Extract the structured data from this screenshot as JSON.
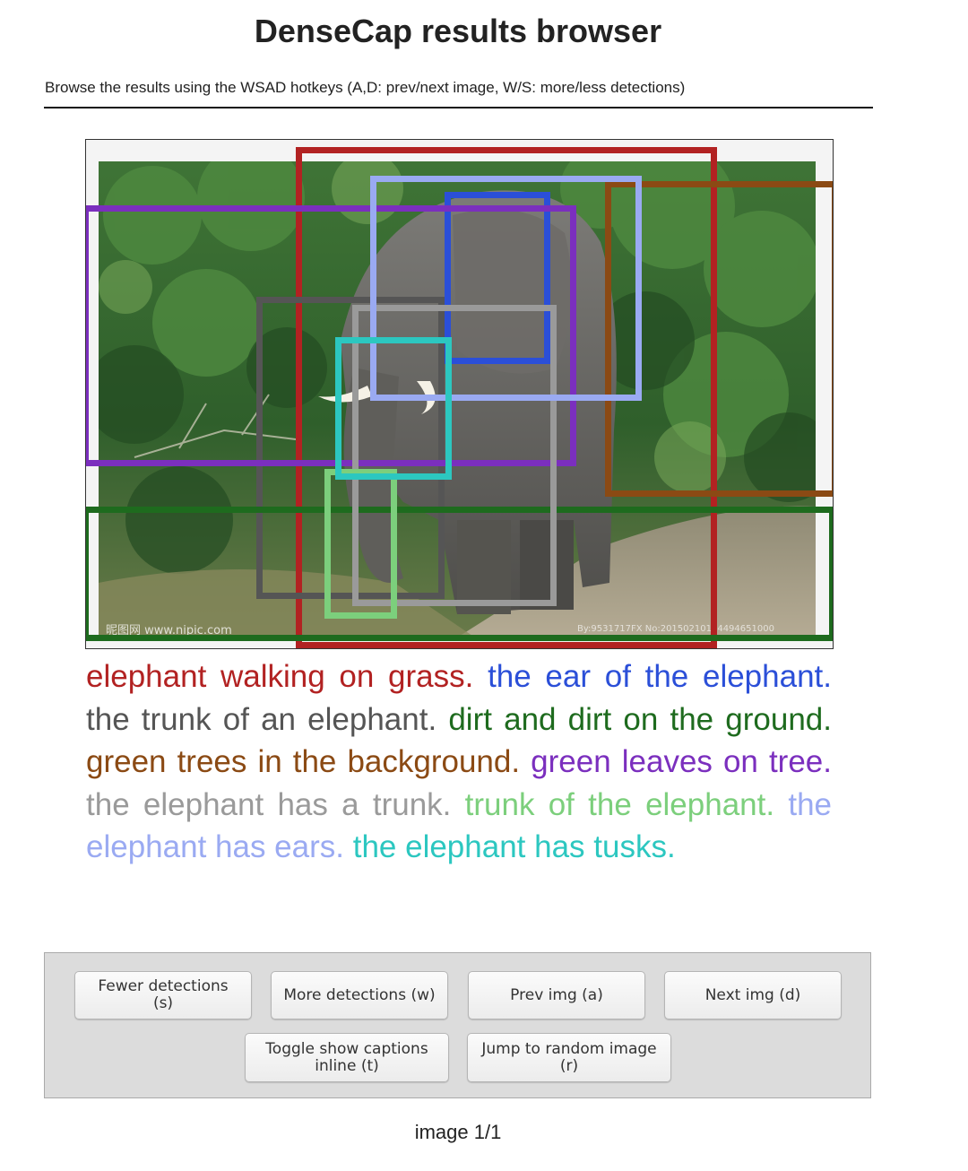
{
  "page": {
    "title": "DenseCap results browser",
    "subtitle": "Browse the results using the WSAD hotkeys (A,D: prev/next image, W/S: more/less detections)"
  },
  "image_viewer": {
    "watermark_left": "昵图网 www.nipic.com",
    "watermark_right": "By:9531717FX No:20150210134494651000"
  },
  "captions": [
    {
      "text": "elephant walking on grass.",
      "color": "#b22222"
    },
    {
      "text": "the ear of the elephant.",
      "color": "#2b4fd8"
    },
    {
      "text": "the trunk of an elephant.",
      "color": "#555555"
    },
    {
      "text": "dirt and dirt on the ground.",
      "color": "#1e6b1e"
    },
    {
      "text": "green trees in the background.",
      "color": "#8b4a14"
    },
    {
      "text": "green leaves on tree.",
      "color": "#7b2fbe"
    },
    {
      "text": "the elephant has a trunk.",
      "color": "#9a9a9a"
    },
    {
      "text": "trunk of the elephant.",
      "color": "#7ccf7c"
    },
    {
      "text": "the elephant has ears.",
      "color": "#9aaaf2"
    },
    {
      "text": "the elephant has tusks.",
      "color": "#2cc7c0"
    }
  ],
  "controls": {
    "fewer_label": "Fewer detections (s)",
    "more_label": "More detections (w)",
    "prev_label": "Prev img (a)",
    "next_label": "Next img (d)",
    "toggle_label": "Toggle show captions inline (t)",
    "random_label": "Jump to random image (r)"
  },
  "footer": {
    "counter": "image 1/1"
  }
}
